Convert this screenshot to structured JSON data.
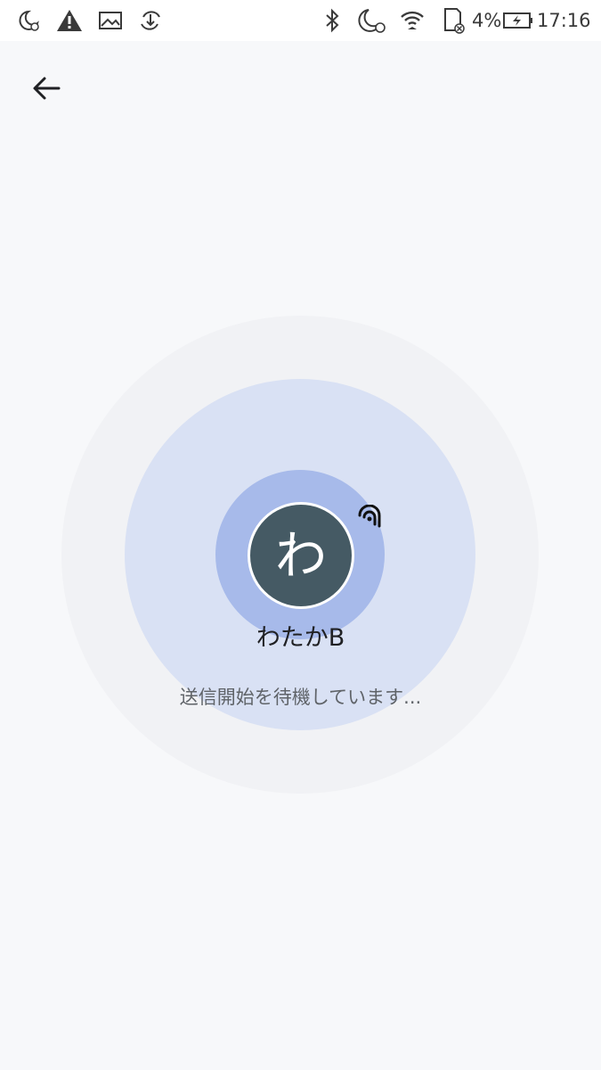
{
  "status_bar": {
    "icons": [
      "moon-alarm-icon",
      "warning-icon",
      "image-icon",
      "sync-download-icon",
      "bluetooth-icon",
      "moon-alarm-icon",
      "wifi-icon",
      "sd-card-icon",
      "battery-charging-icon"
    ],
    "battery_percent": "4%",
    "time": "17:16"
  },
  "toolbar": {
    "back_icon": "arrow-back-icon"
  },
  "device": {
    "avatar_initial": "わ",
    "name": "わたかB",
    "signal_icon": "nearby-signal-icon"
  },
  "message": "送信開始を待機しています...",
  "colors": {
    "background": "#f7f8fa",
    "ring_outer": "#f1f2f5",
    "ring_middle": "#d9e1f4",
    "ring_inner": "#a7baea",
    "avatar_bg": "#455a64"
  }
}
